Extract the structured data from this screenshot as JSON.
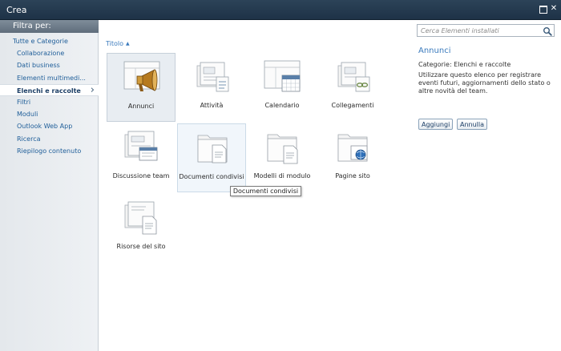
{
  "dialog": {
    "title": "Crea"
  },
  "sidebar": {
    "header": "Filtra per:",
    "items": [
      {
        "label": "Tutte e Categorie",
        "level": 0,
        "selected": false
      },
      {
        "label": "Collaborazione",
        "level": 1,
        "selected": false
      },
      {
        "label": "Dati business",
        "level": 1,
        "selected": false
      },
      {
        "label": "Elementi multimedi...",
        "level": 1,
        "selected": false
      },
      {
        "label": "Elenchi e raccolte",
        "level": 1,
        "selected": true
      },
      {
        "label": "Filtri",
        "level": 1,
        "selected": false
      },
      {
        "label": "Moduli",
        "level": 1,
        "selected": false
      },
      {
        "label": "Outlook Web App",
        "level": 1,
        "selected": false
      },
      {
        "label": "Ricerca",
        "level": 1,
        "selected": false
      },
      {
        "label": "Riepilogo contenuto",
        "level": 1,
        "selected": false
      }
    ]
  },
  "main": {
    "sort_label": "Titolo",
    "sort_arrow": "▲",
    "tiles": [
      {
        "label": "Annunci",
        "icon": "announcement-megaphone-icon",
        "state": "selected"
      },
      {
        "label": "Attività",
        "icon": "task-list-icon",
        "state": "normal"
      },
      {
        "label": "Calendario",
        "icon": "calendar-icon",
        "state": "normal"
      },
      {
        "label": "Collegamenti",
        "icon": "links-list-icon",
        "state": "normal"
      },
      {
        "label": "Discussione team",
        "icon": "discussion-board-icon",
        "state": "normal"
      },
      {
        "label": "Documenti condivisi",
        "icon": "document-library-icon",
        "state": "hover"
      },
      {
        "label": "Modelli di modulo",
        "icon": "form-library-icon",
        "state": "normal"
      },
      {
        "label": "Pagine sito",
        "icon": "site-pages-icon",
        "state": "normal"
      },
      {
        "label": "Risorse del sito",
        "icon": "site-assets-icon",
        "state": "normal"
      }
    ],
    "tooltip": "Documenti condivisi"
  },
  "details": {
    "search_placeholder": "Cerca Elementi installati",
    "title": "Annunci",
    "category": "Categorie: Elenchi e raccolte",
    "description": "Utilizzare questo elenco per registrare eventi futuri, aggiornamenti dello stato o altre novità del team.",
    "add_label": "Aggiungi",
    "cancel_label": "Annulla"
  },
  "colors": {
    "titlebar": "#1e3247",
    "link": "#1f5e99",
    "accent": "#3b7bbd",
    "sidebar": "#e4e8ec"
  }
}
